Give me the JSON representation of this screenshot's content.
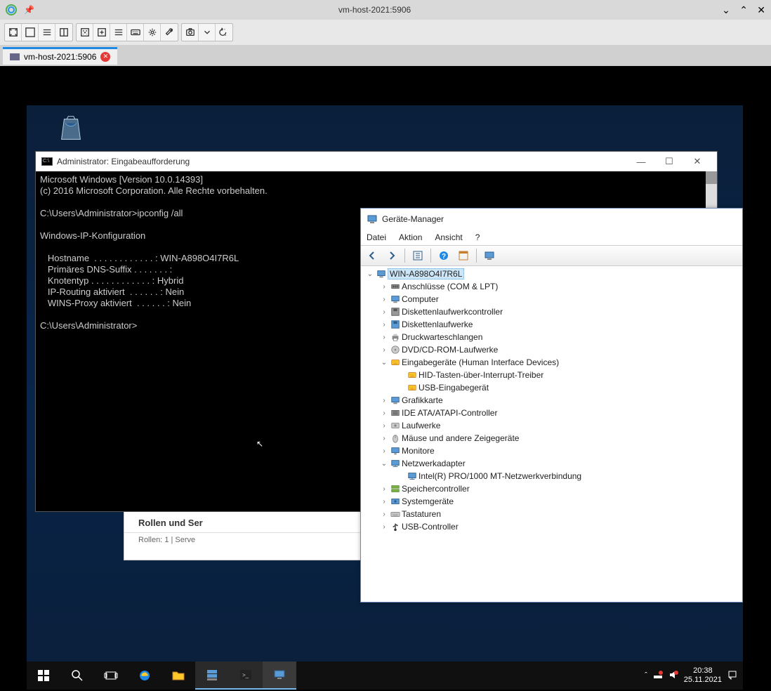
{
  "vnc": {
    "title": "vm-host-2021:5906",
    "tab_label": "vm-host-2021:5906"
  },
  "cmd": {
    "title": "Administrator: Eingabeaufforderung",
    "lines": [
      "Microsoft Windows [Version 10.0.14393]",
      "(c) 2016 Microsoft Corporation. Alle Rechte vorbehalten.",
      "",
      "C:\\Users\\Administrator>ipconfig /all",
      "",
      "Windows-IP-Konfiguration",
      "",
      "   Hostname  . . . . . . . . . . . . : WIN-A898O4I7R6L",
      "   Primäres DNS-Suffix . . . . . . . :",
      "   Knotentyp . . . . . . . . . . . . : Hybrid",
      "   IP-Routing aktiviert  . . . . . . : Nein",
      "   WINS-Proxy aktiviert  . . . . . . : Nein",
      "",
      "C:\\Users\\Administrator>"
    ]
  },
  "devmgr": {
    "title": "Geräte-Manager",
    "menu": {
      "file": "Datei",
      "action": "Aktion",
      "view": "Ansicht",
      "help": "?"
    },
    "root": "WIN-A898O4I7R6L",
    "nodes": [
      {
        "label": "Anschlüsse (COM & LPT)",
        "exp": ">",
        "icon": "port"
      },
      {
        "label": "Computer",
        "exp": ">",
        "icon": "computer"
      },
      {
        "label": "Diskettenlaufwerkcontroller",
        "exp": ">",
        "icon": "floppyctrl"
      },
      {
        "label": "Diskettenlaufwerke",
        "exp": ">",
        "icon": "floppy"
      },
      {
        "label": "Druckwarteschlangen",
        "exp": ">",
        "icon": "printer"
      },
      {
        "label": "DVD/CD-ROM-Laufwerke",
        "exp": ">",
        "icon": "cdrom"
      },
      {
        "label": "Eingabegeräte (Human Interface Devices)",
        "exp": "v",
        "icon": "hid",
        "children": [
          {
            "label": "HID-Tasten-über-Interrupt-Treiber",
            "icon": "hid"
          },
          {
            "label": "USB-Eingabegerät",
            "icon": "hid"
          }
        ]
      },
      {
        "label": "Grafikkarte",
        "exp": ">",
        "icon": "display"
      },
      {
        "label": "IDE ATA/ATAPI-Controller",
        "exp": ">",
        "icon": "ide"
      },
      {
        "label": "Laufwerke",
        "exp": ">",
        "icon": "disk"
      },
      {
        "label": "Mäuse und andere Zeigegeräte",
        "exp": ">",
        "icon": "mouse"
      },
      {
        "label": "Monitore",
        "exp": ">",
        "icon": "monitor"
      },
      {
        "label": "Netzwerkadapter",
        "exp": "v",
        "icon": "network",
        "children": [
          {
            "label": "Intel(R) PRO/1000 MT-Netzwerkverbindung",
            "icon": "network"
          }
        ]
      },
      {
        "label": "Speichercontroller",
        "exp": ">",
        "icon": "storage"
      },
      {
        "label": "Systemgeräte",
        "exp": ">",
        "icon": "system"
      },
      {
        "label": "Tastaturen",
        "exp": ">",
        "icon": "keyboard"
      },
      {
        "label": "USB-Controller",
        "exp": ">",
        "icon": "usb"
      }
    ]
  },
  "srvmgr": {
    "heading": "Rollen und Ser",
    "roles_label": "Rollen:",
    "roles_count": "1",
    "divider": "|",
    "server_label": "Serve"
  },
  "taskbar": {
    "time": "20:38",
    "date": "25.11.2021"
  }
}
